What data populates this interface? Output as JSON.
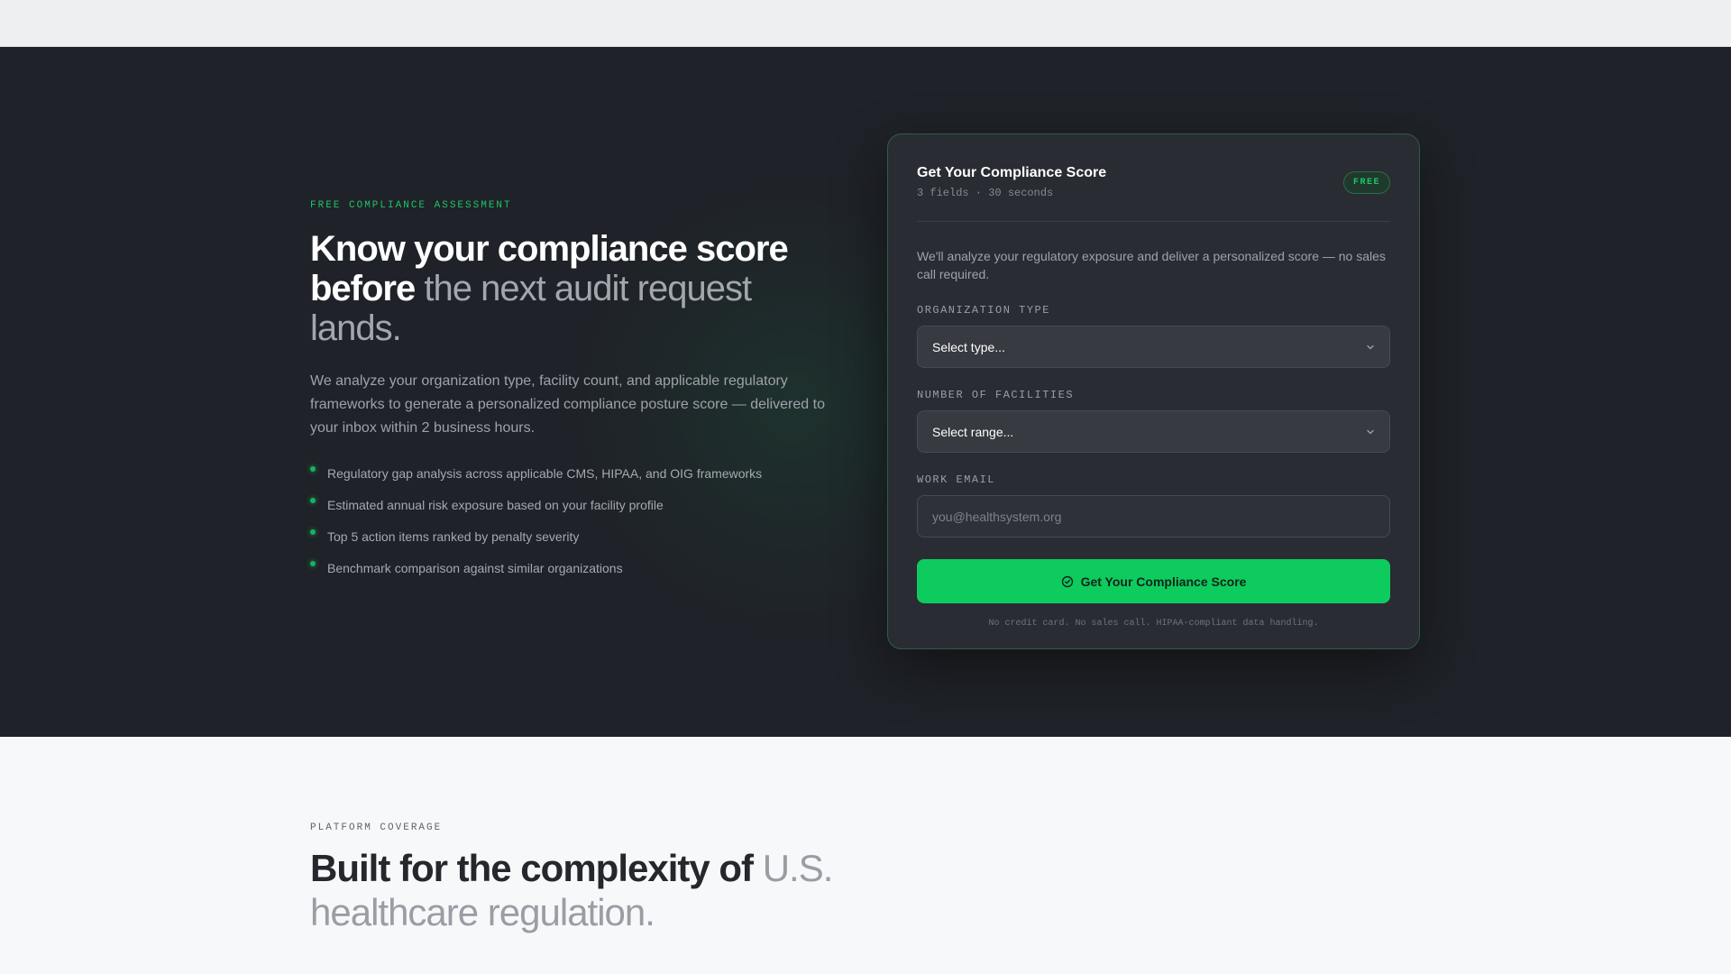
{
  "hero": {
    "eyebrow": "FREE COMPLIANCE ASSESSMENT",
    "title_strong": "Know your compliance score before",
    "title_muted": "the next audit request lands.",
    "description": "We analyze your organization type, facility count, and applicable regulatory frameworks to generate a personalized compliance posture score — delivered to your inbox within 2 business hours.",
    "bullets": [
      "Regulatory gap analysis across applicable CMS, HIPAA, and OIG frameworks",
      "Estimated annual risk exposure based on your facility profile",
      "Top 5 action items ranked by penalty severity",
      "Benchmark comparison against similar organizations"
    ]
  },
  "card": {
    "title": "Get Your Compliance Score",
    "subtitle": "3 fields · 30 seconds",
    "badge": "FREE",
    "intro": "We'll analyze your regulatory exposure and deliver a personalized score — no sales call required.",
    "org_type": {
      "label": "ORGANIZATION TYPE",
      "value": "Select type..."
    },
    "facilities": {
      "label": "NUMBER OF FACILITIES",
      "value": "Select range..."
    },
    "email": {
      "label": "WORK EMAIL",
      "placeholder": "you@healthsystem.org",
      "value": ""
    },
    "cta_label": "Get Your Compliance Score",
    "fineprint": "No credit card. No sales call. HIPAA-compliant data handling."
  },
  "coverage": {
    "eyebrow": "PLATFORM COVERAGE",
    "title_strong": "Built for the complexity of",
    "title_muted": "U.S. healthcare regulation."
  },
  "colors": {
    "accent": "#0ecb5e",
    "hero_bg": "#1f2228",
    "card_bg": "#292c32"
  },
  "icons": {
    "chevron": "chevron-down-icon",
    "cta": "check-circle-icon",
    "bullet": "bullet-dot-icon"
  }
}
